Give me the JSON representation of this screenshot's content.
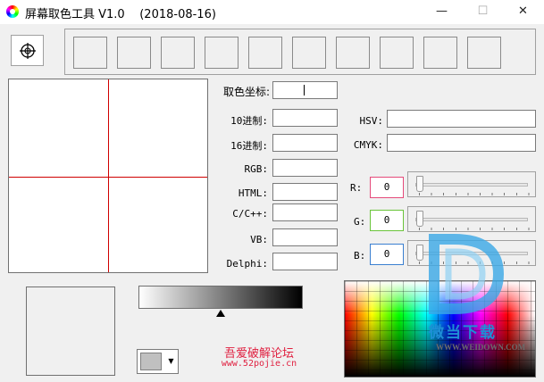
{
  "window": {
    "title": "屏幕取色工具 V1.0    (2018-08-16)",
    "min_glyph": "—",
    "max_glyph": "☐",
    "close_glyph": "✕"
  },
  "picker": {
    "icon": "crosshair-target-icon"
  },
  "swatch_count": 10,
  "labels": {
    "coord": "取色坐标:",
    "dec": "10进制:",
    "hex": "16进制:",
    "rgb": "RGB:",
    "html": "HTML:",
    "cpp": "C/C++:",
    "vb": "VB:",
    "delphi": "Delphi:",
    "hsv": "HSV:",
    "cmyk": "CMYK:",
    "r": "R:",
    "g": "G:",
    "b": "B:"
  },
  "values": {
    "coord": "",
    "dec": "",
    "hex": "",
    "rgb": "",
    "html": "",
    "cpp": "",
    "vb": "",
    "delphi": "",
    "hsv": "",
    "cmyk": "",
    "r": "0",
    "g": "0",
    "b": "0"
  },
  "colors": {
    "r_border": "#e54a7a",
    "g_border": "#6ac43a",
    "b_border": "#3a7fd0",
    "crosshair": "#d00000",
    "combo_color": "#c0c0c0",
    "forum_text": "#e02040",
    "watermark": "#1e8fd6"
  },
  "bottom": {
    "combo_arrow": "▼",
    "forum_name": "吾爱破解论坛",
    "forum_url": "www.52pojie.cn"
  },
  "watermark": {
    "text": "微当下载",
    "url": "WWW.WEIDOWN.COM"
  }
}
